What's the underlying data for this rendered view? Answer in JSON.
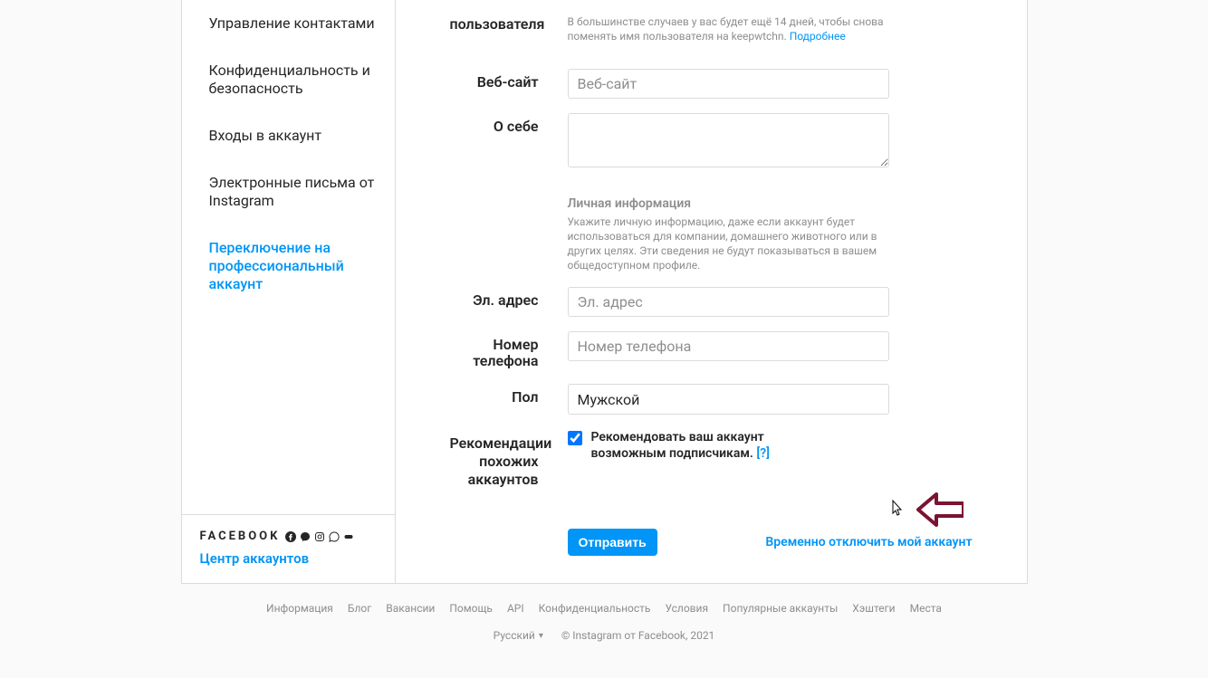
{
  "sidebar": {
    "items": [
      {
        "label": "Управление контактами"
      },
      {
        "label": "Конфиденциальность и безопасность"
      },
      {
        "label": "Входы в аккаунт"
      },
      {
        "label": "Электронные письма от Instagram"
      },
      {
        "label": "Переключение на профессиональный аккаунт",
        "is_link": true
      }
    ],
    "footer": {
      "brand_word": "FACEBOOK",
      "accounts_center": "Центр аккаунтов"
    }
  },
  "form": {
    "username_label": "пользователя",
    "username_help_prefix": "В большинстве случаев у вас будет ещё 14 дней, чтобы снова поменять имя пользователя на keepwtchn. ",
    "username_help_link": "Подробнее",
    "website_label": "Веб-сайт",
    "website_placeholder": "Веб-сайт",
    "bio_label": "О себе",
    "personal_heading": "Личная информация",
    "personal_text": "Укажите личную информацию, даже если аккаунт будет использоваться для компании, домашнего животного или в других целях. Эти сведения не будут показываться в вашем общедоступном профиле.",
    "email_label": "Эл. адрес",
    "email_placeholder": "Эл. адрес",
    "phone_label": "Номер телефона",
    "phone_placeholder": "Номер телефона",
    "gender_label": "Пол",
    "gender_value": "Мужской",
    "similar_label": "Рекомендации похожих аккаунтов",
    "similar_checkbox_label": "Рекомендовать ваш аккаунт возможным подписчикам.",
    "similar_help": "[?]",
    "submit": "Отправить",
    "disable_link": "Временно отключить мой аккаунт"
  },
  "footer": {
    "links": [
      "Информация",
      "Блог",
      "Вакансии",
      "Помощь",
      "API",
      "Конфиденциальность",
      "Условия",
      "Популярные аккаунты",
      "Хэштеги",
      "Места"
    ],
    "language": "Русский",
    "copyright": "© Instagram от Facebook, 2021"
  }
}
